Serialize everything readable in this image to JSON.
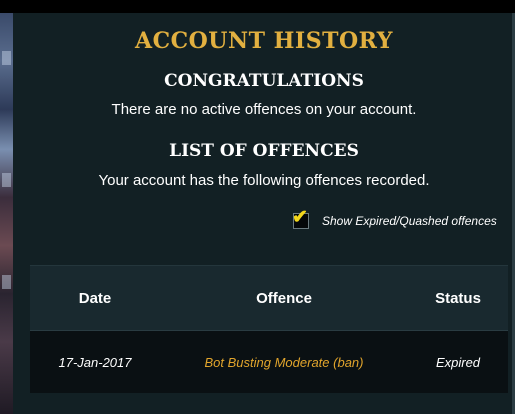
{
  "page": {
    "title": "ACCOUNT HISTORY",
    "congrats_heading": "CONGRATULATIONS",
    "congrats_message": "There are no active offences on your account.",
    "offences_heading": "LIST OF OFFENCES",
    "offences_message": "Your account has the following offences recorded."
  },
  "filter": {
    "label": "Show Expired/Quashed offences",
    "checked": true,
    "check_glyph": "✔"
  },
  "table": {
    "headers": {
      "date": "Date",
      "offence": "Offence",
      "status": "Status"
    },
    "rows": [
      {
        "date": "17-Jan-2017",
        "offence": "Bot Busting Moderate (ban)",
        "status": "Expired"
      }
    ]
  },
  "colors": {
    "title_gold": "#e2b040",
    "offence_orange": "#e2a52c",
    "checkbox_yellow": "#f2d61b",
    "panel_bg": "#122024"
  }
}
